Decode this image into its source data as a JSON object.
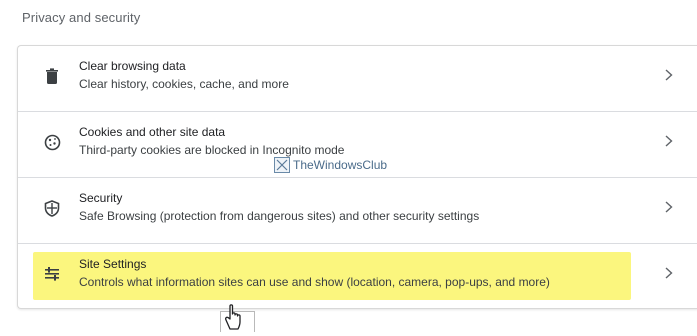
{
  "section_title": "Privacy and security",
  "rows": [
    {
      "icon": "trash-icon",
      "title": "Clear browsing data",
      "desc": "Clear history, cookies, cache, and more"
    },
    {
      "icon": "cookie-icon",
      "title": "Cookies and other site data",
      "desc": "Third-party cookies are blocked in Incognito mode"
    },
    {
      "icon": "shield-icon",
      "title": "Security",
      "desc": "Safe Browsing (protection from dangerous sites) and other security settings"
    },
    {
      "icon": "sliders-icon",
      "title": "Site Settings",
      "desc": "Controls what information sites can use and show (location, camera, pop-ups, and more)"
    }
  ],
  "watermark": "TheWindowsClub",
  "colors": {
    "highlight": "#fbf67e",
    "text": "#202124",
    "secondary": "#5f6368"
  }
}
